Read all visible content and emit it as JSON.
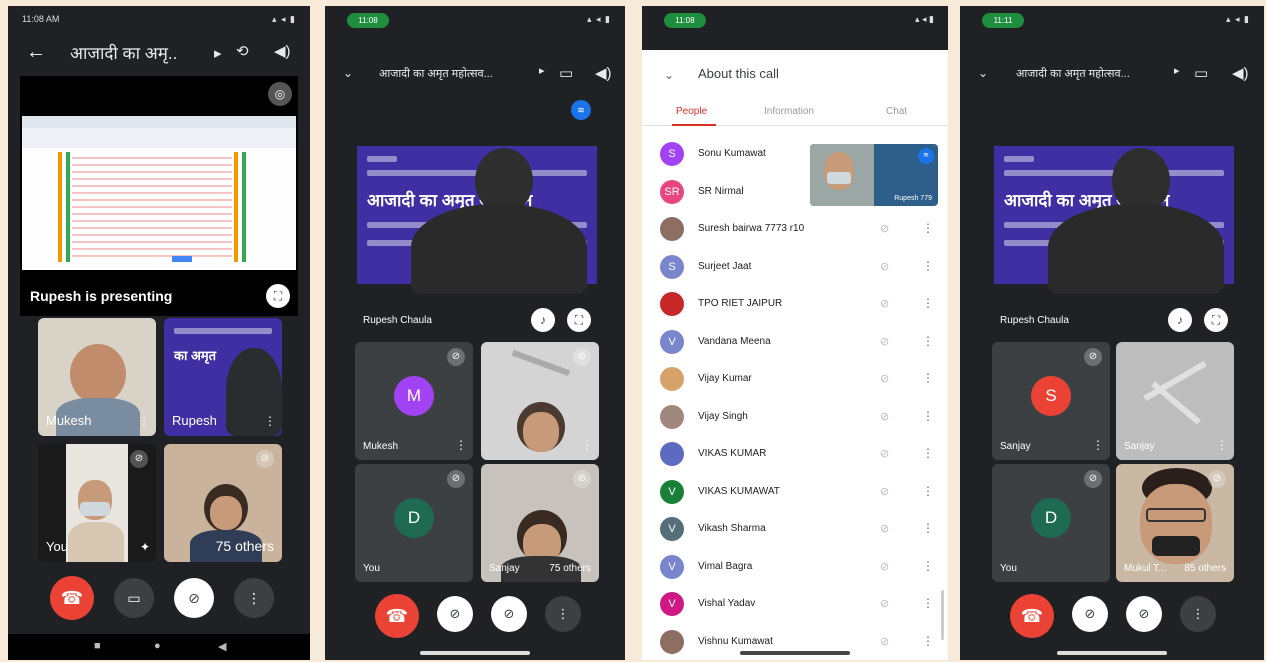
{
  "p1": {
    "time": "11:08 AM",
    "title": "आजादी का अमृ..",
    "presenting": "Rupesh is presenting",
    "tiles": [
      "Mukesh",
      "Rupesh",
      "You",
      "75 others"
    ]
  },
  "p2": {
    "time": "11:08",
    "title": "आजादी का अमृत महोत्सव...",
    "main_name": "Rupesh Chaula",
    "banner_text": "आजादी का अमृत अभियान",
    "tiles": [
      {
        "name": "Mukesh",
        "initial": "M",
        "color": "#a142f4"
      },
      {
        "name": ""
      },
      {
        "name": "You",
        "initial": "D",
        "color": "#1e6b52"
      },
      {
        "name": "Sanjay",
        "extra": "75 others"
      }
    ]
  },
  "p3": {
    "time": "11:08",
    "title": "About this call",
    "tabs": [
      "People",
      "Information",
      "Chat"
    ],
    "pip_name": "Rupesh 779",
    "people": [
      {
        "name": "Sonu Kumawat",
        "initial": "S",
        "color": "#a142f4"
      },
      {
        "name": "SR Nirmal",
        "initial": "SR",
        "color": "#e8467c"
      },
      {
        "name": "Suresh bairwa 7773 r10",
        "initial": "",
        "color": "#8d6e63"
      },
      {
        "name": "Surjeet Jaat",
        "initial": "S",
        "color": "#7986cb"
      },
      {
        "name": "TPO RIET JAIPUR",
        "initial": "",
        "color": "#c62828"
      },
      {
        "name": "Vandana Meena",
        "initial": "V",
        "color": "#7986cb"
      },
      {
        "name": "Vijay Kumar",
        "initial": "",
        "color": "#d7a26a"
      },
      {
        "name": "Vijay Singh",
        "initial": "",
        "color": "#a1887f"
      },
      {
        "name": "VIKAS KUMAR",
        "initial": "",
        "color": "#5c6bc0"
      },
      {
        "name": "VIKAS KUMAWAT",
        "initial": "V",
        "color": "#188038"
      },
      {
        "name": "Vikash Sharma",
        "initial": "V",
        "color": "#546e7a"
      },
      {
        "name": "Vimal Bagra",
        "initial": "V",
        "color": "#7986cb"
      },
      {
        "name": "Vishal Yadav",
        "initial": "V",
        "color": "#d01884"
      },
      {
        "name": "Vishnu Kumawat",
        "initial": "",
        "color": "#8d6e63"
      }
    ]
  },
  "p4": {
    "time": "11:11",
    "title": "आजादी का अमृत महोत्सव...",
    "main_name": "Rupesh Chaula",
    "tiles": [
      {
        "name": "Sanjay",
        "initial": "S",
        "color": "#ea4335"
      },
      {
        "name": "Sanjay"
      },
      {
        "name": "You",
        "initial": "D",
        "color": "#1e6b52"
      },
      {
        "name": "Mukul T...",
        "extra": "85 others"
      }
    ]
  }
}
